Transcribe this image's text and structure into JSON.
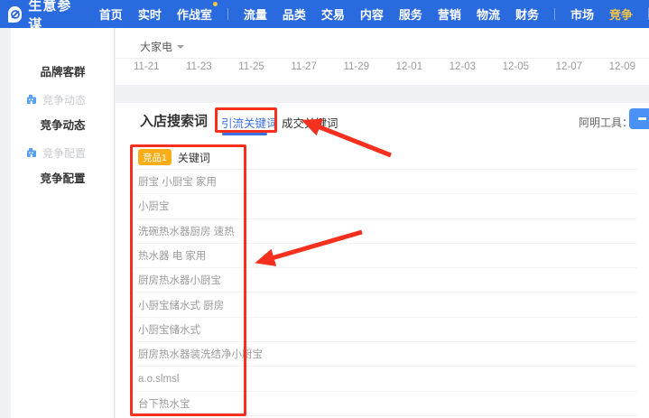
{
  "navbar": {
    "brand": "生意参谋",
    "items": [
      {
        "label": "首页"
      },
      {
        "label": "实时"
      },
      {
        "label": "作战室",
        "badge_dot": true
      },
      {
        "label": "流量"
      },
      {
        "label": "品类"
      },
      {
        "label": "交易"
      },
      {
        "label": "内容"
      },
      {
        "label": "服务"
      },
      {
        "label": "营销"
      },
      {
        "label": "物流"
      },
      {
        "label": "财务"
      },
      {
        "label": "市场"
      },
      {
        "label": "竞争",
        "active": true
      }
    ]
  },
  "sidebar": {
    "items": [
      {
        "label": "品牌客群",
        "type": "group"
      },
      {
        "label": "竞争动态",
        "type": "link",
        "icon": "building-icon"
      },
      {
        "label": "竞争动态",
        "type": "group"
      },
      {
        "label": "竞争配置",
        "type": "link",
        "icon": "building-icon"
      },
      {
        "label": "竞争配置",
        "type": "group"
      }
    ]
  },
  "filter": {
    "category": "大家电"
  },
  "timeline": {
    "dates": [
      "11-21",
      "11-23",
      "11-25",
      "11-27",
      "11-29",
      "12-01",
      "12-03",
      "12-05",
      "12-07",
      "12-09"
    ]
  },
  "section": {
    "title": "入店搜索词",
    "tabs": [
      {
        "label": "引流关键词",
        "active": true
      },
      {
        "label": "成交关键词",
        "active": false
      }
    ],
    "tools_label": "阿明工具："
  },
  "keyword_table": {
    "competitor_badge": "竞品1",
    "column_header": "关键词",
    "rows": [
      "厨宝 小厨宝 家用",
      "小厨宝",
      "洗碗热水器厨房 速热",
      "热水器 电 家用",
      "厨房热水器小厨宝",
      "小厨宝储水式 厨房",
      "小厨宝储水式",
      "厨房热水器装洗结净小厨宝",
      "a.o.slmsl",
      "台下热水宝"
    ]
  },
  "colors": {
    "navbar_blue": "#2A6ADF",
    "active_yellow": "#F6C443",
    "tab_blue": "#3A70DF",
    "badge_orange": "#FBAD17",
    "annotation_red": "#F5301E",
    "button_blue": "#4A90F5"
  }
}
